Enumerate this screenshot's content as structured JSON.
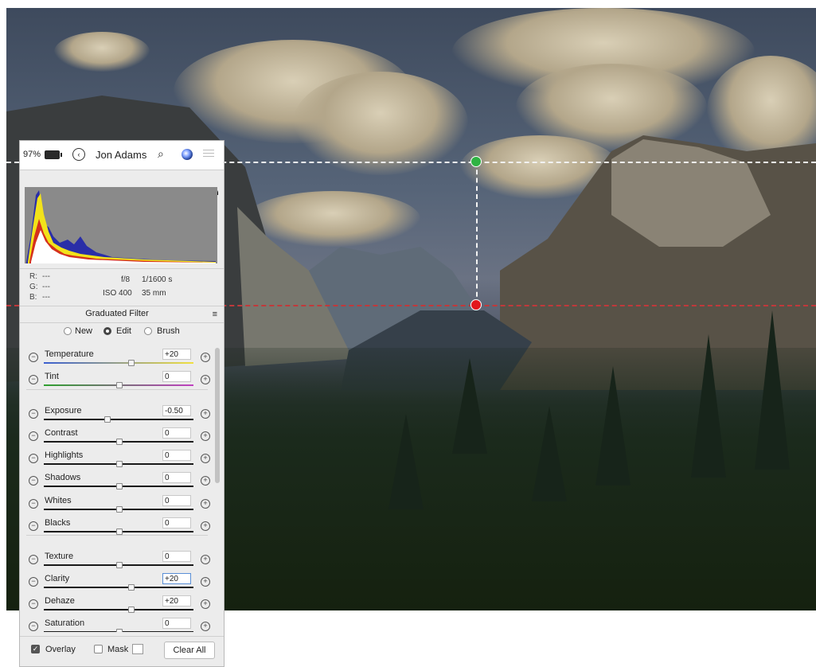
{
  "status_bar": {
    "battery": "97%",
    "user": "Jon Adams"
  },
  "info": {
    "r_label": "R:",
    "r_value": "---",
    "g_label": "G:",
    "g_value": "---",
    "b_label": "B:",
    "b_value": "---",
    "aperture": "f/8",
    "shutter": "1/1600 s",
    "iso": "ISO 400",
    "focal": "35 mm"
  },
  "filter": {
    "title": "Graduated Filter",
    "modes": [
      {
        "label": "New",
        "selected": false
      },
      {
        "label": "Edit",
        "selected": true
      },
      {
        "label": "Brush",
        "selected": false
      }
    ]
  },
  "sliders": [
    {
      "label": "Temperature",
      "value": "+20",
      "level": 0.58
    },
    {
      "label": "Tint",
      "value": "0",
      "level": 0.5
    },
    {
      "label": "Exposure",
      "value": "-0.50",
      "level": 0.42
    },
    {
      "label": "Contrast",
      "value": "0",
      "level": 0.5
    },
    {
      "label": "Highlights",
      "value": "0",
      "level": 0.5
    },
    {
      "label": "Shadows",
      "value": "0",
      "level": 0.5
    },
    {
      "label": "Whites",
      "value": "0",
      "level": 0.5
    },
    {
      "label": "Blacks",
      "value": "0",
      "level": 0.5
    },
    {
      "label": "Texture",
      "value": "0",
      "level": 0.5
    },
    {
      "label": "Clarity",
      "value": "+20",
      "level": 0.58
    },
    {
      "label": "Dehaze",
      "value": "+20",
      "level": 0.58
    },
    {
      "label": "Saturation",
      "value": "0",
      "level": 0.5
    }
  ],
  "footer": {
    "overlay_label": "Overlay",
    "overlay_checked": true,
    "mask_label": "Mask",
    "mask_checked": false,
    "clear_all_label": "Clear All"
  },
  "colors": {
    "guide_top_pin": "#2fb343",
    "guide_bottom_pin": "#e3171c",
    "histogram_bg": "#8a8a8a",
    "histogram_blue": "#2a2ea8",
    "histogram_yellow": "#f2e21a",
    "histogram_red": "#d21e1e"
  }
}
